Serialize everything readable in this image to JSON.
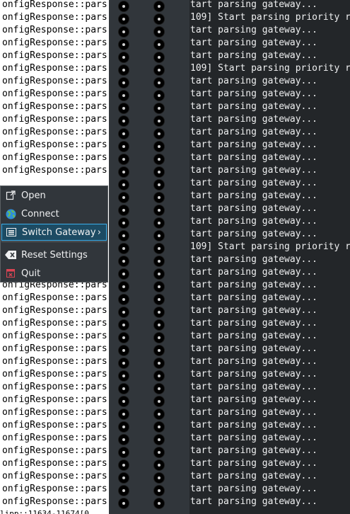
{
  "log": {
    "left_text": "onfigResponse::pars",
    "right_gateway": "tart parsing gateway...",
    "right_priority": "109] Start parsing priority r",
    "priority_rows": [
      1,
      5,
      19
    ],
    "bottom_fragment": "lipp::11634-11674[0"
  },
  "menu": {
    "items": [
      {
        "label": "Open",
        "icon": "open-icon"
      },
      {
        "label": "Connect",
        "icon": "globe-icon"
      },
      {
        "label": "Switch Gateway",
        "icon": "switch-gateway-icon",
        "submenu": true
      },
      {
        "label": "Reset Settings",
        "icon": "reset-icon"
      },
      {
        "label": "Quit",
        "icon": "quit-icon"
      }
    ]
  },
  "colors": {
    "accent": "#3daee9",
    "menu_bg": "#31363b",
    "terminal_bg": "#232629"
  }
}
